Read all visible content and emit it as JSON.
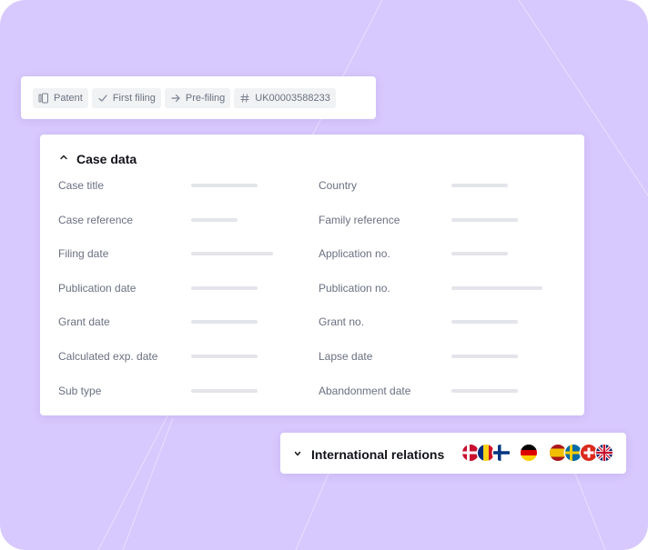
{
  "breadcrumb": {
    "items": [
      {
        "label": "Patent",
        "icon": "document-icon"
      },
      {
        "label": "First filing",
        "icon": "check-icon"
      },
      {
        "label": "Pre-filing",
        "icon": "arrow-right-icon"
      },
      {
        "label": "UK00003588233",
        "icon": "hash-icon"
      }
    ]
  },
  "case_data": {
    "title": "Case data",
    "expanded": true,
    "left_fields": [
      "Case title",
      "Case reference",
      "Filing date",
      "Publication date",
      "Grant date",
      "Calculated exp. date",
      "Sub type"
    ],
    "right_fields": [
      "Country",
      "Family reference",
      "Application no.",
      "Publication no.",
      "Grant no.",
      "Lapse date",
      "Abandonment date"
    ]
  },
  "international_relations": {
    "title": "International relations",
    "expanded": false,
    "flags": [
      "denmark-flag-icon",
      "romania-flag-icon",
      "finland-flag-icon",
      "germany-flag-icon",
      "spain-flag-icon",
      "sweden-flag-icon",
      "switzerland-flag-icon",
      "united-kingdom-flag-icon"
    ]
  },
  "colors": {
    "background": "#d7c8fd",
    "card": "#ffffff",
    "placeholder_bar": "#e3e5ea",
    "label_text": "#6b7080",
    "title_text": "#111318"
  }
}
